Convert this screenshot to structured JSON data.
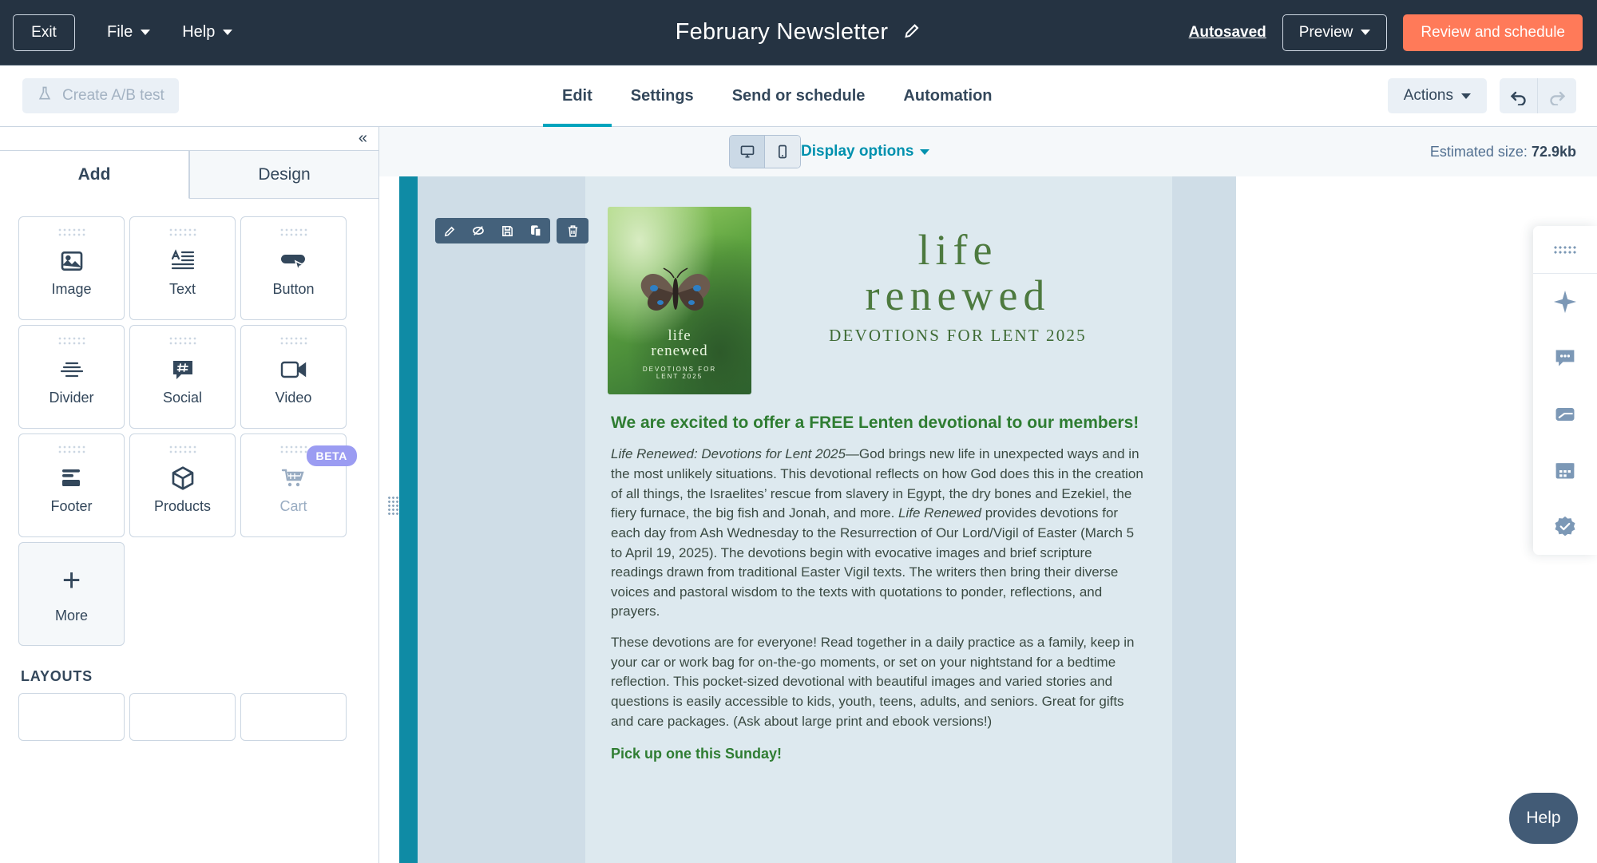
{
  "header": {
    "exit_label": "Exit",
    "menus": [
      {
        "label": "File",
        "icon": "chevron-down-icon"
      },
      {
        "label": "Help",
        "icon": "chevron-down-icon"
      }
    ],
    "title": "February  Newsletter",
    "title_edit_icon": "pencil-icon",
    "autosaved_label": "Autosaved",
    "preview_label": "Preview",
    "review_label": "Review and schedule",
    "accent_color": "#ff7a59",
    "background_color": "#253342"
  },
  "subnav": {
    "ab_test_label": "Create A/B test",
    "ab_test_icon": "flask-icon",
    "tabs": [
      {
        "label": "Edit",
        "active": true
      },
      {
        "label": "Settings",
        "active": false
      },
      {
        "label": "Send or schedule",
        "active": false
      },
      {
        "label": "Automation",
        "active": false
      }
    ],
    "actions_label": "Actions",
    "undo_icon": "undo-arrow-icon",
    "redo_icon": "redo-arrow-icon",
    "active_tab_color": "#00a4bd"
  },
  "sidebar": {
    "collapse_icon": "double-chevron-left-icon",
    "panel_tabs": [
      {
        "label": "Add",
        "active": true
      },
      {
        "label": "Design",
        "active": false
      }
    ],
    "modules": [
      {
        "label": "Image",
        "icon": "image-icon",
        "muted": false,
        "badge": ""
      },
      {
        "label": "Text",
        "icon": "text-icon",
        "muted": false,
        "badge": ""
      },
      {
        "label": "Button",
        "icon": "button-icon",
        "muted": false,
        "badge": ""
      },
      {
        "label": "Divider",
        "icon": "divider-icon",
        "muted": false,
        "badge": ""
      },
      {
        "label": "Social",
        "icon": "social-icon",
        "muted": false,
        "badge": ""
      },
      {
        "label": "Video",
        "icon": "video-icon",
        "muted": false,
        "badge": ""
      },
      {
        "label": "Footer",
        "icon": "footer-icon",
        "muted": false,
        "badge": ""
      },
      {
        "label": "Products",
        "icon": "box-icon",
        "muted": false,
        "badge": ""
      },
      {
        "label": "Cart",
        "icon": "cart-icon",
        "muted": true,
        "badge": "BETA"
      }
    ],
    "more_label": "More",
    "more_icon": "plus-icon",
    "layouts_header": "LAYOUTS",
    "beta_badge_color": "#9b9cf2"
  },
  "canvas": {
    "device_desktop_icon": "desktop-icon",
    "device_mobile_icon": "mobile-icon",
    "active_device": "desktop",
    "display_options_label": "Display options",
    "estimated_size_label": "Estimated size:",
    "estimated_size_value": "72.9kb",
    "module_toolbar": [
      {
        "icon": "pencil-icon",
        "name": "edit"
      },
      {
        "icon": "eye-slash-icon",
        "name": "hide"
      },
      {
        "icon": "save-icon",
        "name": "save"
      },
      {
        "icon": "duplicate-icon",
        "name": "clone"
      },
      {
        "icon": "trash-icon",
        "name": "delete"
      }
    ],
    "accent_strip_color": "#0f8ba5"
  },
  "email": {
    "book_cover": {
      "line1": "life",
      "line2": "renewed",
      "line3": "DEVOTIONS FOR",
      "line4": "LENT 2025"
    },
    "hero": {
      "line1": "life",
      "line2": "renewed",
      "subtitle": "DEVOTIONS FOR LENT 2025",
      "heading_color": "#4d7a3f"
    },
    "headline": "We are excited to offer a FREE Lenten devotional to our members!",
    "paragraph1_italic": "Life Renewed: Devotions for Lent 2025",
    "paragraph1_rest": "—God brings new life in unexpected ways and in the most unlikely situations. This devotional reflects on how God does this in the creation of all things, the Israelites’ rescue from slavery in Egypt, the dry bones and Ezekiel, the fiery furnace, the big fish and Jonah, and more. ",
    "paragraph1_italic2": "Life Renewed",
    "paragraph1_rest2": " provides devotions for each day from Ash Wednesday to the Resurrection of Our Lord/Vigil of Easter (March 5 to April 19, 2025). The devotions begin with evocative images and brief scripture readings drawn from traditional Easter Vigil texts. The writers then bring their diverse voices and pastoral wisdom to the texts with quotations to ponder, reflections, and prayers.",
    "paragraph2": "These devotions are for everyone! Read together in a daily practice as a family, keep in your car or work bag for on-the-go moments, or set on your nightstand for a bedtime reflection. This pocket-sized devotional with beautiful images and varied stories and questions is easily accessible to kids, youth, teens, adults, and seniors. Great for gifts and care packages. (Ask about large print and ebook versions!)",
    "cta": "Pick up one this Sunday!"
  },
  "rail": {
    "grip_icon": "drag-grip-icon",
    "icons": [
      {
        "icon": "sparkle-icon",
        "name": "ai-assistant"
      },
      {
        "icon": "comment-icon",
        "name": "comments"
      },
      {
        "icon": "card-icon",
        "name": "preview-card"
      },
      {
        "icon": "calendar-icon",
        "name": "calendar"
      },
      {
        "icon": "badge-check-icon",
        "name": "quality-check"
      }
    ]
  },
  "help": {
    "label": "Help"
  }
}
